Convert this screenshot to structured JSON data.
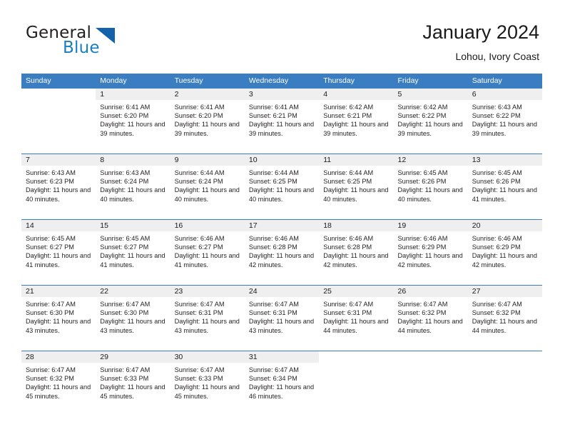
{
  "brand": {
    "name_part1": "General",
    "name_part2": "Blue",
    "triangle_color": "#1362ab",
    "blue_color": "#1a7fc1"
  },
  "header": {
    "title": "January 2024",
    "subtitle": "Lohou, Ivory Coast"
  },
  "theme": {
    "header_blue": "#3a7dc0",
    "daynum_band": "#efefef",
    "text": "#231f20"
  },
  "weekdays": [
    "Sunday",
    "Monday",
    "Tuesday",
    "Wednesday",
    "Thursday",
    "Friday",
    "Saturday"
  ],
  "weeks": [
    [
      {
        "day": "",
        "sunrise": "",
        "sunset": "",
        "daylight": "",
        "blank": true
      },
      {
        "day": "1",
        "sunrise": "Sunrise: 6:41 AM",
        "sunset": "Sunset: 6:20 PM",
        "daylight": "Daylight: 11 hours and 39 minutes."
      },
      {
        "day": "2",
        "sunrise": "Sunrise: 6:41 AM",
        "sunset": "Sunset: 6:20 PM",
        "daylight": "Daylight: 11 hours and 39 minutes."
      },
      {
        "day": "3",
        "sunrise": "Sunrise: 6:41 AM",
        "sunset": "Sunset: 6:21 PM",
        "daylight": "Daylight: 11 hours and 39 minutes."
      },
      {
        "day": "4",
        "sunrise": "Sunrise: 6:42 AM",
        "sunset": "Sunset: 6:21 PM",
        "daylight": "Daylight: 11 hours and 39 minutes."
      },
      {
        "day": "5",
        "sunrise": "Sunrise: 6:42 AM",
        "sunset": "Sunset: 6:22 PM",
        "daylight": "Daylight: 11 hours and 39 minutes."
      },
      {
        "day": "6",
        "sunrise": "Sunrise: 6:43 AM",
        "sunset": "Sunset: 6:22 PM",
        "daylight": "Daylight: 11 hours and 39 minutes."
      }
    ],
    [
      {
        "day": "7",
        "sunrise": "Sunrise: 6:43 AM",
        "sunset": "Sunset: 6:23 PM",
        "daylight": "Daylight: 11 hours and 40 minutes."
      },
      {
        "day": "8",
        "sunrise": "Sunrise: 6:43 AM",
        "sunset": "Sunset: 6:24 PM",
        "daylight": "Daylight: 11 hours and 40 minutes."
      },
      {
        "day": "9",
        "sunrise": "Sunrise: 6:44 AM",
        "sunset": "Sunset: 6:24 PM",
        "daylight": "Daylight: 11 hours and 40 minutes."
      },
      {
        "day": "10",
        "sunrise": "Sunrise: 6:44 AM",
        "sunset": "Sunset: 6:25 PM",
        "daylight": "Daylight: 11 hours and 40 minutes."
      },
      {
        "day": "11",
        "sunrise": "Sunrise: 6:44 AM",
        "sunset": "Sunset: 6:25 PM",
        "daylight": "Daylight: 11 hours and 40 minutes."
      },
      {
        "day": "12",
        "sunrise": "Sunrise: 6:45 AM",
        "sunset": "Sunset: 6:26 PM",
        "daylight": "Daylight: 11 hours and 40 minutes."
      },
      {
        "day": "13",
        "sunrise": "Sunrise: 6:45 AM",
        "sunset": "Sunset: 6:26 PM",
        "daylight": "Daylight: 11 hours and 41 minutes."
      }
    ],
    [
      {
        "day": "14",
        "sunrise": "Sunrise: 6:45 AM",
        "sunset": "Sunset: 6:27 PM",
        "daylight": "Daylight: 11 hours and 41 minutes."
      },
      {
        "day": "15",
        "sunrise": "Sunrise: 6:45 AM",
        "sunset": "Sunset: 6:27 PM",
        "daylight": "Daylight: 11 hours and 41 minutes."
      },
      {
        "day": "16",
        "sunrise": "Sunrise: 6:46 AM",
        "sunset": "Sunset: 6:27 PM",
        "daylight": "Daylight: 11 hours and 41 minutes."
      },
      {
        "day": "17",
        "sunrise": "Sunrise: 6:46 AM",
        "sunset": "Sunset: 6:28 PM",
        "daylight": "Daylight: 11 hours and 42 minutes."
      },
      {
        "day": "18",
        "sunrise": "Sunrise: 6:46 AM",
        "sunset": "Sunset: 6:28 PM",
        "daylight": "Daylight: 11 hours and 42 minutes."
      },
      {
        "day": "19",
        "sunrise": "Sunrise: 6:46 AM",
        "sunset": "Sunset: 6:29 PM",
        "daylight": "Daylight: 11 hours and 42 minutes."
      },
      {
        "day": "20",
        "sunrise": "Sunrise: 6:46 AM",
        "sunset": "Sunset: 6:29 PM",
        "daylight": "Daylight: 11 hours and 42 minutes."
      }
    ],
    [
      {
        "day": "21",
        "sunrise": "Sunrise: 6:47 AM",
        "sunset": "Sunset: 6:30 PM",
        "daylight": "Daylight: 11 hours and 43 minutes."
      },
      {
        "day": "22",
        "sunrise": "Sunrise: 6:47 AM",
        "sunset": "Sunset: 6:30 PM",
        "daylight": "Daylight: 11 hours and 43 minutes."
      },
      {
        "day": "23",
        "sunrise": "Sunrise: 6:47 AM",
        "sunset": "Sunset: 6:31 PM",
        "daylight": "Daylight: 11 hours and 43 minutes."
      },
      {
        "day": "24",
        "sunrise": "Sunrise: 6:47 AM",
        "sunset": "Sunset: 6:31 PM",
        "daylight": "Daylight: 11 hours and 43 minutes."
      },
      {
        "day": "25",
        "sunrise": "Sunrise: 6:47 AM",
        "sunset": "Sunset: 6:31 PM",
        "daylight": "Daylight: 11 hours and 44 minutes."
      },
      {
        "day": "26",
        "sunrise": "Sunrise: 6:47 AM",
        "sunset": "Sunset: 6:32 PM",
        "daylight": "Daylight: 11 hours and 44 minutes."
      },
      {
        "day": "27",
        "sunrise": "Sunrise: 6:47 AM",
        "sunset": "Sunset: 6:32 PM",
        "daylight": "Daylight: 11 hours and 44 minutes."
      }
    ],
    [
      {
        "day": "28",
        "sunrise": "Sunrise: 6:47 AM",
        "sunset": "Sunset: 6:32 PM",
        "daylight": "Daylight: 11 hours and 45 minutes."
      },
      {
        "day": "29",
        "sunrise": "Sunrise: 6:47 AM",
        "sunset": "Sunset: 6:33 PM",
        "daylight": "Daylight: 11 hours and 45 minutes."
      },
      {
        "day": "30",
        "sunrise": "Sunrise: 6:47 AM",
        "sunset": "Sunset: 6:33 PM",
        "daylight": "Daylight: 11 hours and 45 minutes."
      },
      {
        "day": "31",
        "sunrise": "Sunrise: 6:47 AM",
        "sunset": "Sunset: 6:34 PM",
        "daylight": "Daylight: 11 hours and 46 minutes."
      },
      {
        "day": "",
        "sunrise": "",
        "sunset": "",
        "daylight": "",
        "blank": true
      },
      {
        "day": "",
        "sunrise": "",
        "sunset": "",
        "daylight": "",
        "blank": true
      },
      {
        "day": "",
        "sunrise": "",
        "sunset": "",
        "daylight": "",
        "blank": true
      }
    ]
  ]
}
